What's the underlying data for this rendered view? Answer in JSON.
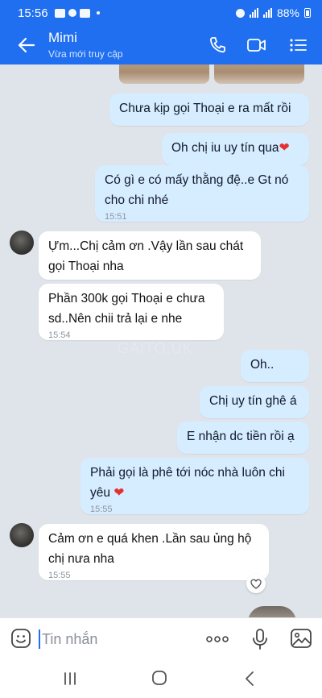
{
  "status_bar": {
    "time": "15:56",
    "battery": "88%"
  },
  "header": {
    "contact_name": "Mimi",
    "contact_status": "Vừa mới truy cập"
  },
  "messages": [
    {
      "side": "me",
      "text": "Chưa kịp gọi Thoại e ra mất rồi",
      "time": ""
    },
    {
      "side": "me",
      "text": "Oh chị iu uy tín qua",
      "emoji": "❤",
      "time": ""
    },
    {
      "side": "me",
      "text": "Có gì e có mấy thằng đệ..e Gt nó cho chi nhé",
      "time": "15:51"
    },
    {
      "side": "them",
      "text": "Ựm...Chị cảm ơn .Vậy lần sau chát gọi Thoại nha",
      "time": ""
    },
    {
      "side": "them",
      "text": "Phần 300k gọi Thoại e chưa sd..Nên chii trả lại e nhe",
      "time": "15:54"
    },
    {
      "side": "me",
      "text": "Oh..",
      "time": ""
    },
    {
      "side": "me",
      "text": "Chị uy tín ghê á",
      "time": ""
    },
    {
      "side": "me",
      "text": "E nhận dc tiền rồi ạ",
      "time": ""
    },
    {
      "side": "me",
      "text": "Phải gọi là phê tới nóc nhà luôn chi yêu",
      "emoji": "❤",
      "time": "15:55"
    },
    {
      "side": "them",
      "text": "Cảm ơn e quá khen .Lần sau ủng hộ chị nưa nha",
      "time": "15:55"
    }
  ],
  "watermark": "GAITO.UK",
  "input": {
    "placeholder": "Tin nhắn"
  },
  "icons": {
    "back": "arrow-left-icon",
    "call": "phone-icon",
    "video": "video-camera-icon",
    "menu": "list-menu-icon",
    "emoji": "smiley-icon",
    "more": "more-dots-icon",
    "mic": "microphone-icon",
    "image": "image-icon",
    "react": "heart-outline-icon"
  },
  "colors": {
    "brand": "#1f6ff0",
    "my_bubble": "#d6ecff",
    "their_bubble": "#ffffff",
    "chat_bg": "#dfe4ea",
    "heart": "#e5302f"
  }
}
